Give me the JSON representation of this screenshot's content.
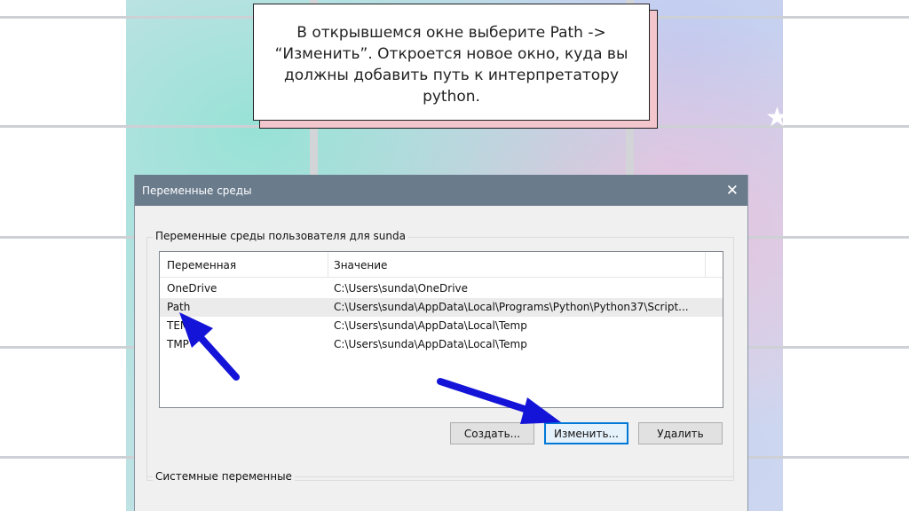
{
  "note": {
    "text_line1": "В открывшемся окне выберите Path ->",
    "text_line2": "“Изменить”. Откроется новое окно, куда вы",
    "text_line3": "должны добавить путь к интерпретатору",
    "text_line4": "python."
  },
  "dialog": {
    "title": "Переменные среды",
    "close_glyph": "✕",
    "user_group_label": "Переменные среды пользователя для sunda",
    "columns": {
      "variable": "Переменная",
      "value": "Значение"
    },
    "rows": [
      {
        "name": "OneDrive",
        "value": "C:\\Users\\sunda\\OneDrive"
      },
      {
        "name": "Path",
        "value": "C:\\Users\\sunda\\AppData\\Local\\Programs\\Python\\Python37\\Script..."
      },
      {
        "name": "TEMP",
        "value": "C:\\Users\\sunda\\AppData\\Local\\Temp"
      },
      {
        "name": "TMP",
        "value": "C:\\Users\\sunda\\AppData\\Local\\Temp"
      }
    ],
    "buttons": {
      "create": "Создать...",
      "edit": "Изменить...",
      "delete": "Удалить"
    },
    "system_group_label": "Системные переменные"
  },
  "colors": {
    "arrow": "#1414d8",
    "titlebar": "#6a7b8c",
    "note_shadow": "#f2c6cc"
  },
  "icons": {
    "sparkle": "star-icon",
    "close": "close-icon"
  }
}
